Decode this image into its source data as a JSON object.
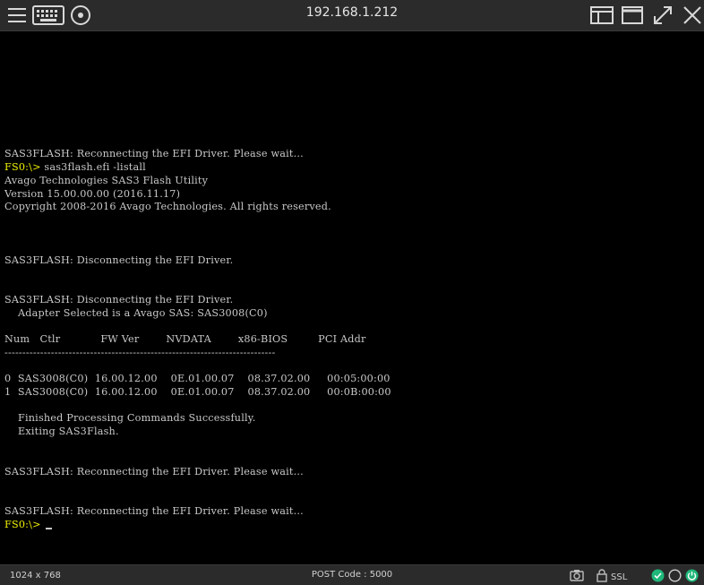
{
  "window": {
    "title": "192.168.1.212"
  },
  "toolbar": {
    "icons": [
      "hamburger-menu-icon",
      "keyboard-icon",
      "disc-icon",
      "split-view-icon",
      "window-icon",
      "expand-icon",
      "close-icon"
    ]
  },
  "console": {
    "lines": [
      {
        "prompt": "",
        "text": "SAS3FLASH: Reconnecting the EFI Driver. Please wait..."
      },
      {
        "prompt": "FS0:\\>",
        "text": " sas3flash.efi -listall"
      },
      {
        "prompt": "",
        "text": "Avago Technologies SAS3 Flash Utility"
      },
      {
        "prompt": "",
        "text": "Version 15.00.00.00 (2016.11.17)"
      },
      {
        "prompt": "",
        "text": "Copyright 2008-2016 Avago Technologies. All rights reserved."
      },
      {
        "prompt": "",
        "text": "SAS3FLASH: Disconnecting the EFI Driver."
      },
      {
        "prompt": "",
        "text": "SAS3FLASH: Disconnecting the EFI Driver."
      },
      {
        "prompt": "",
        "text": "    Adapter Selected is a Avago SAS: SAS3008(C0)"
      },
      {
        "prompt": "",
        "text": "Num   Ctlr            FW Ver        NVDATA        x86-BIOS         PCI Addr"
      },
      {
        "prompt": "",
        "text": "----------------------------------------------------------------------------"
      },
      {
        "prompt": "",
        "text": "0  SAS3008(C0)  16.00.12.00    0E.01.00.07    08.37.02.00     00:05:00:00"
      },
      {
        "prompt": "",
        "text": "1  SAS3008(C0)  16.00.12.00    0E.01.00.07    08.37.02.00     00:0B:00:00"
      },
      {
        "prompt": "",
        "text": "    Finished Processing Commands Successfully."
      },
      {
        "prompt": "",
        "text": "    Exiting SAS3Flash."
      },
      {
        "prompt": "",
        "text": "SAS3FLASH: Reconnecting the EFI Driver. Please wait..."
      },
      {
        "prompt": "",
        "text": "SAS3FLASH: Reconnecting the EFI Driver. Please wait..."
      },
      {
        "prompt": "FS0:\\>",
        "text": " "
      }
    ],
    "colors": {
      "text": "#c8c8c8",
      "prompt": "#f0f000",
      "background": "#000000"
    }
  },
  "statusbar": {
    "resolution": "1024 x 768",
    "post_code": "POST Code  :  5000",
    "ssl_label": "SSL",
    "icons": [
      "camera-icon",
      "lock-icon",
      "status-ok-icon",
      "circle-icon",
      "power-icon"
    ],
    "colors": {
      "ok": "#1fb87a",
      "power": "#1fb87a"
    }
  }
}
